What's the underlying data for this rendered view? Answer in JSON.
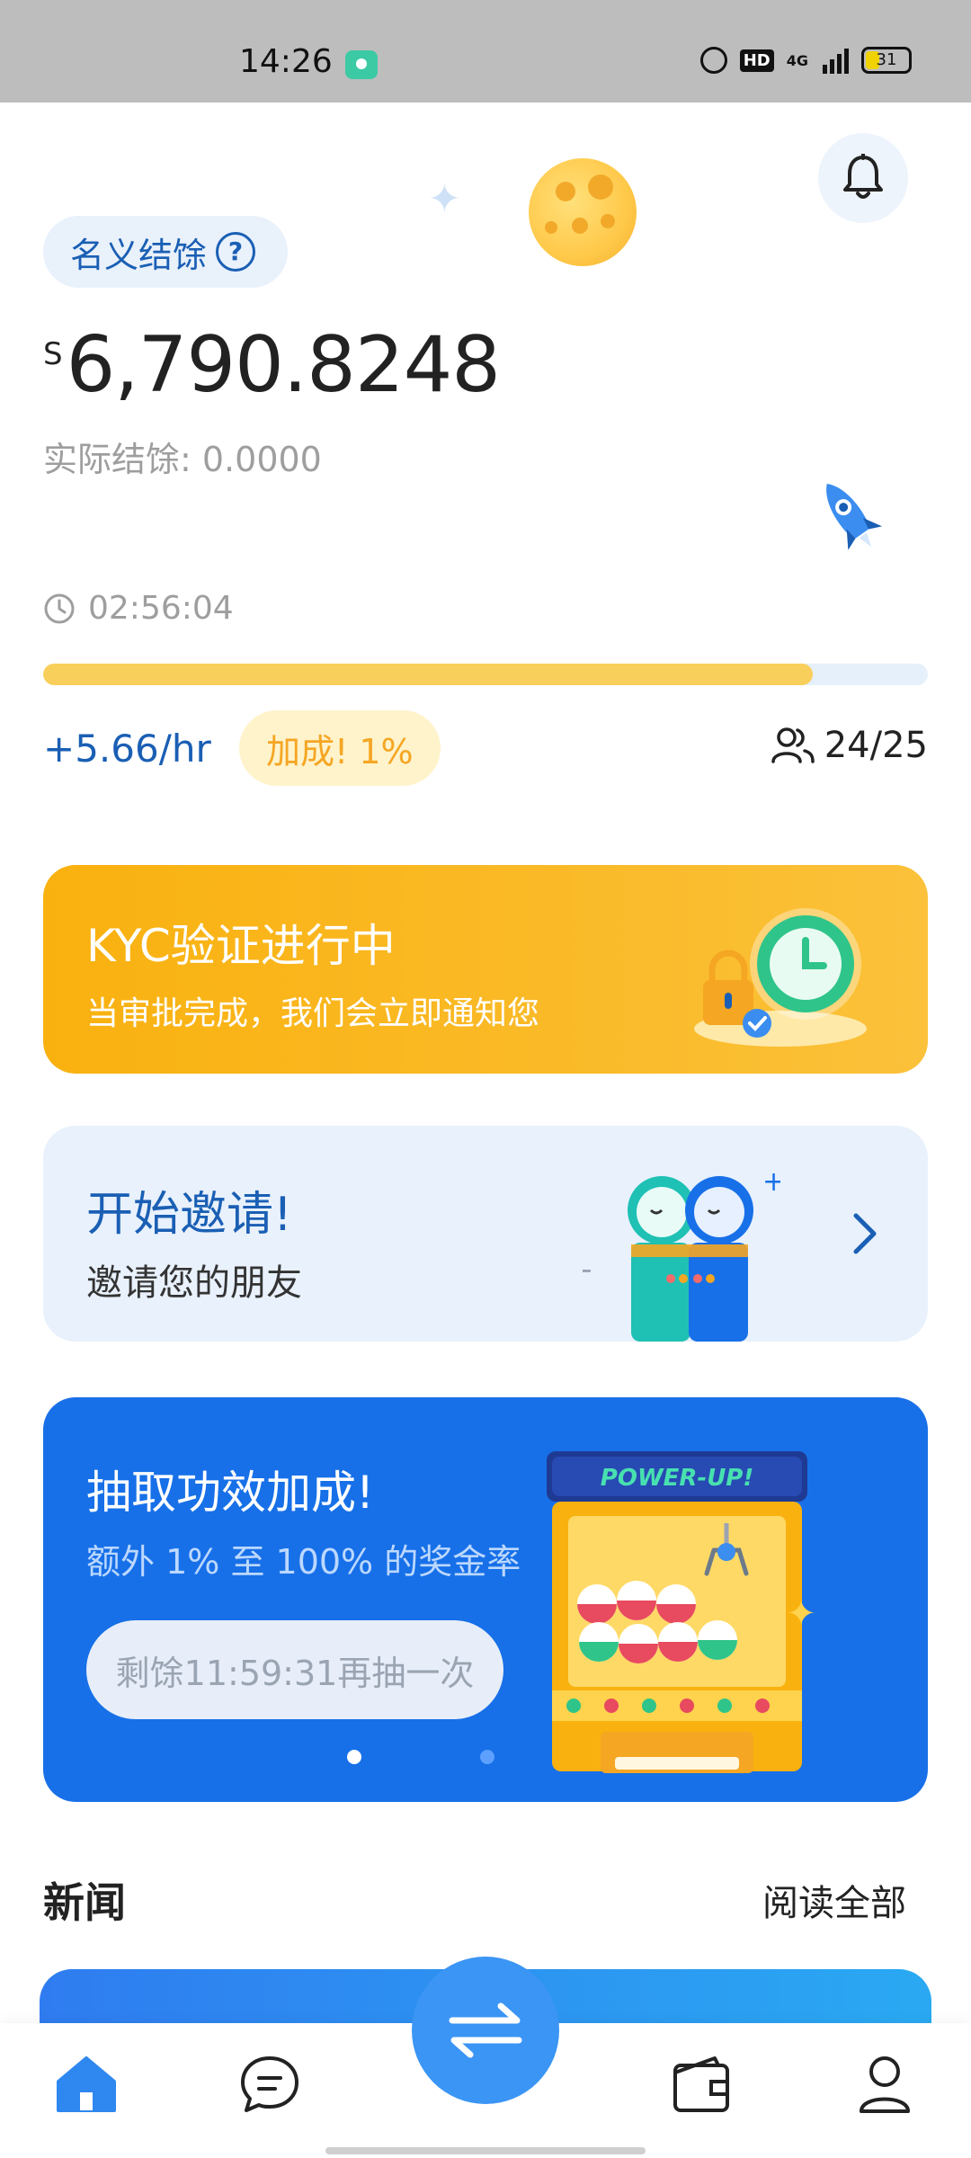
{
  "status_bar": {
    "time": "14:26",
    "hd": "HD",
    "network": "4G",
    "battery": "31"
  },
  "balance": {
    "nominal_label": "名义结馀",
    "help_glyph": "?",
    "currency": "S",
    "amount": "6,790.8248",
    "actual": "实际结馀: 0.0000",
    "timer": "02:56:04",
    "progress_fraction": 0.87,
    "rate": "+5.66/hr",
    "boost": "加成! 1%",
    "team": "24/25"
  },
  "kyc_card": {
    "title": "KYC验证进行中",
    "subtitle": "当审批完成，我们会立即通知您"
  },
  "invite_card": {
    "title": "开始邀请!",
    "subtitle": "邀请您的朋友"
  },
  "powerup_card": {
    "title": "抽取功效加成!",
    "subtitle": "额外 1% 至 100% 的奖金率",
    "button": "剩馀11:59:31再抽一次",
    "machine_label": "POWER-UP!"
  },
  "news": {
    "title": "新闻",
    "read_all": "阅读全部"
  },
  "colors": {
    "brand_blue": "#1a5fb4",
    "accent_blue": "#1770e8",
    "kyc_orange": "#f9b10f",
    "progress_yellow": "#f9cf5b"
  }
}
